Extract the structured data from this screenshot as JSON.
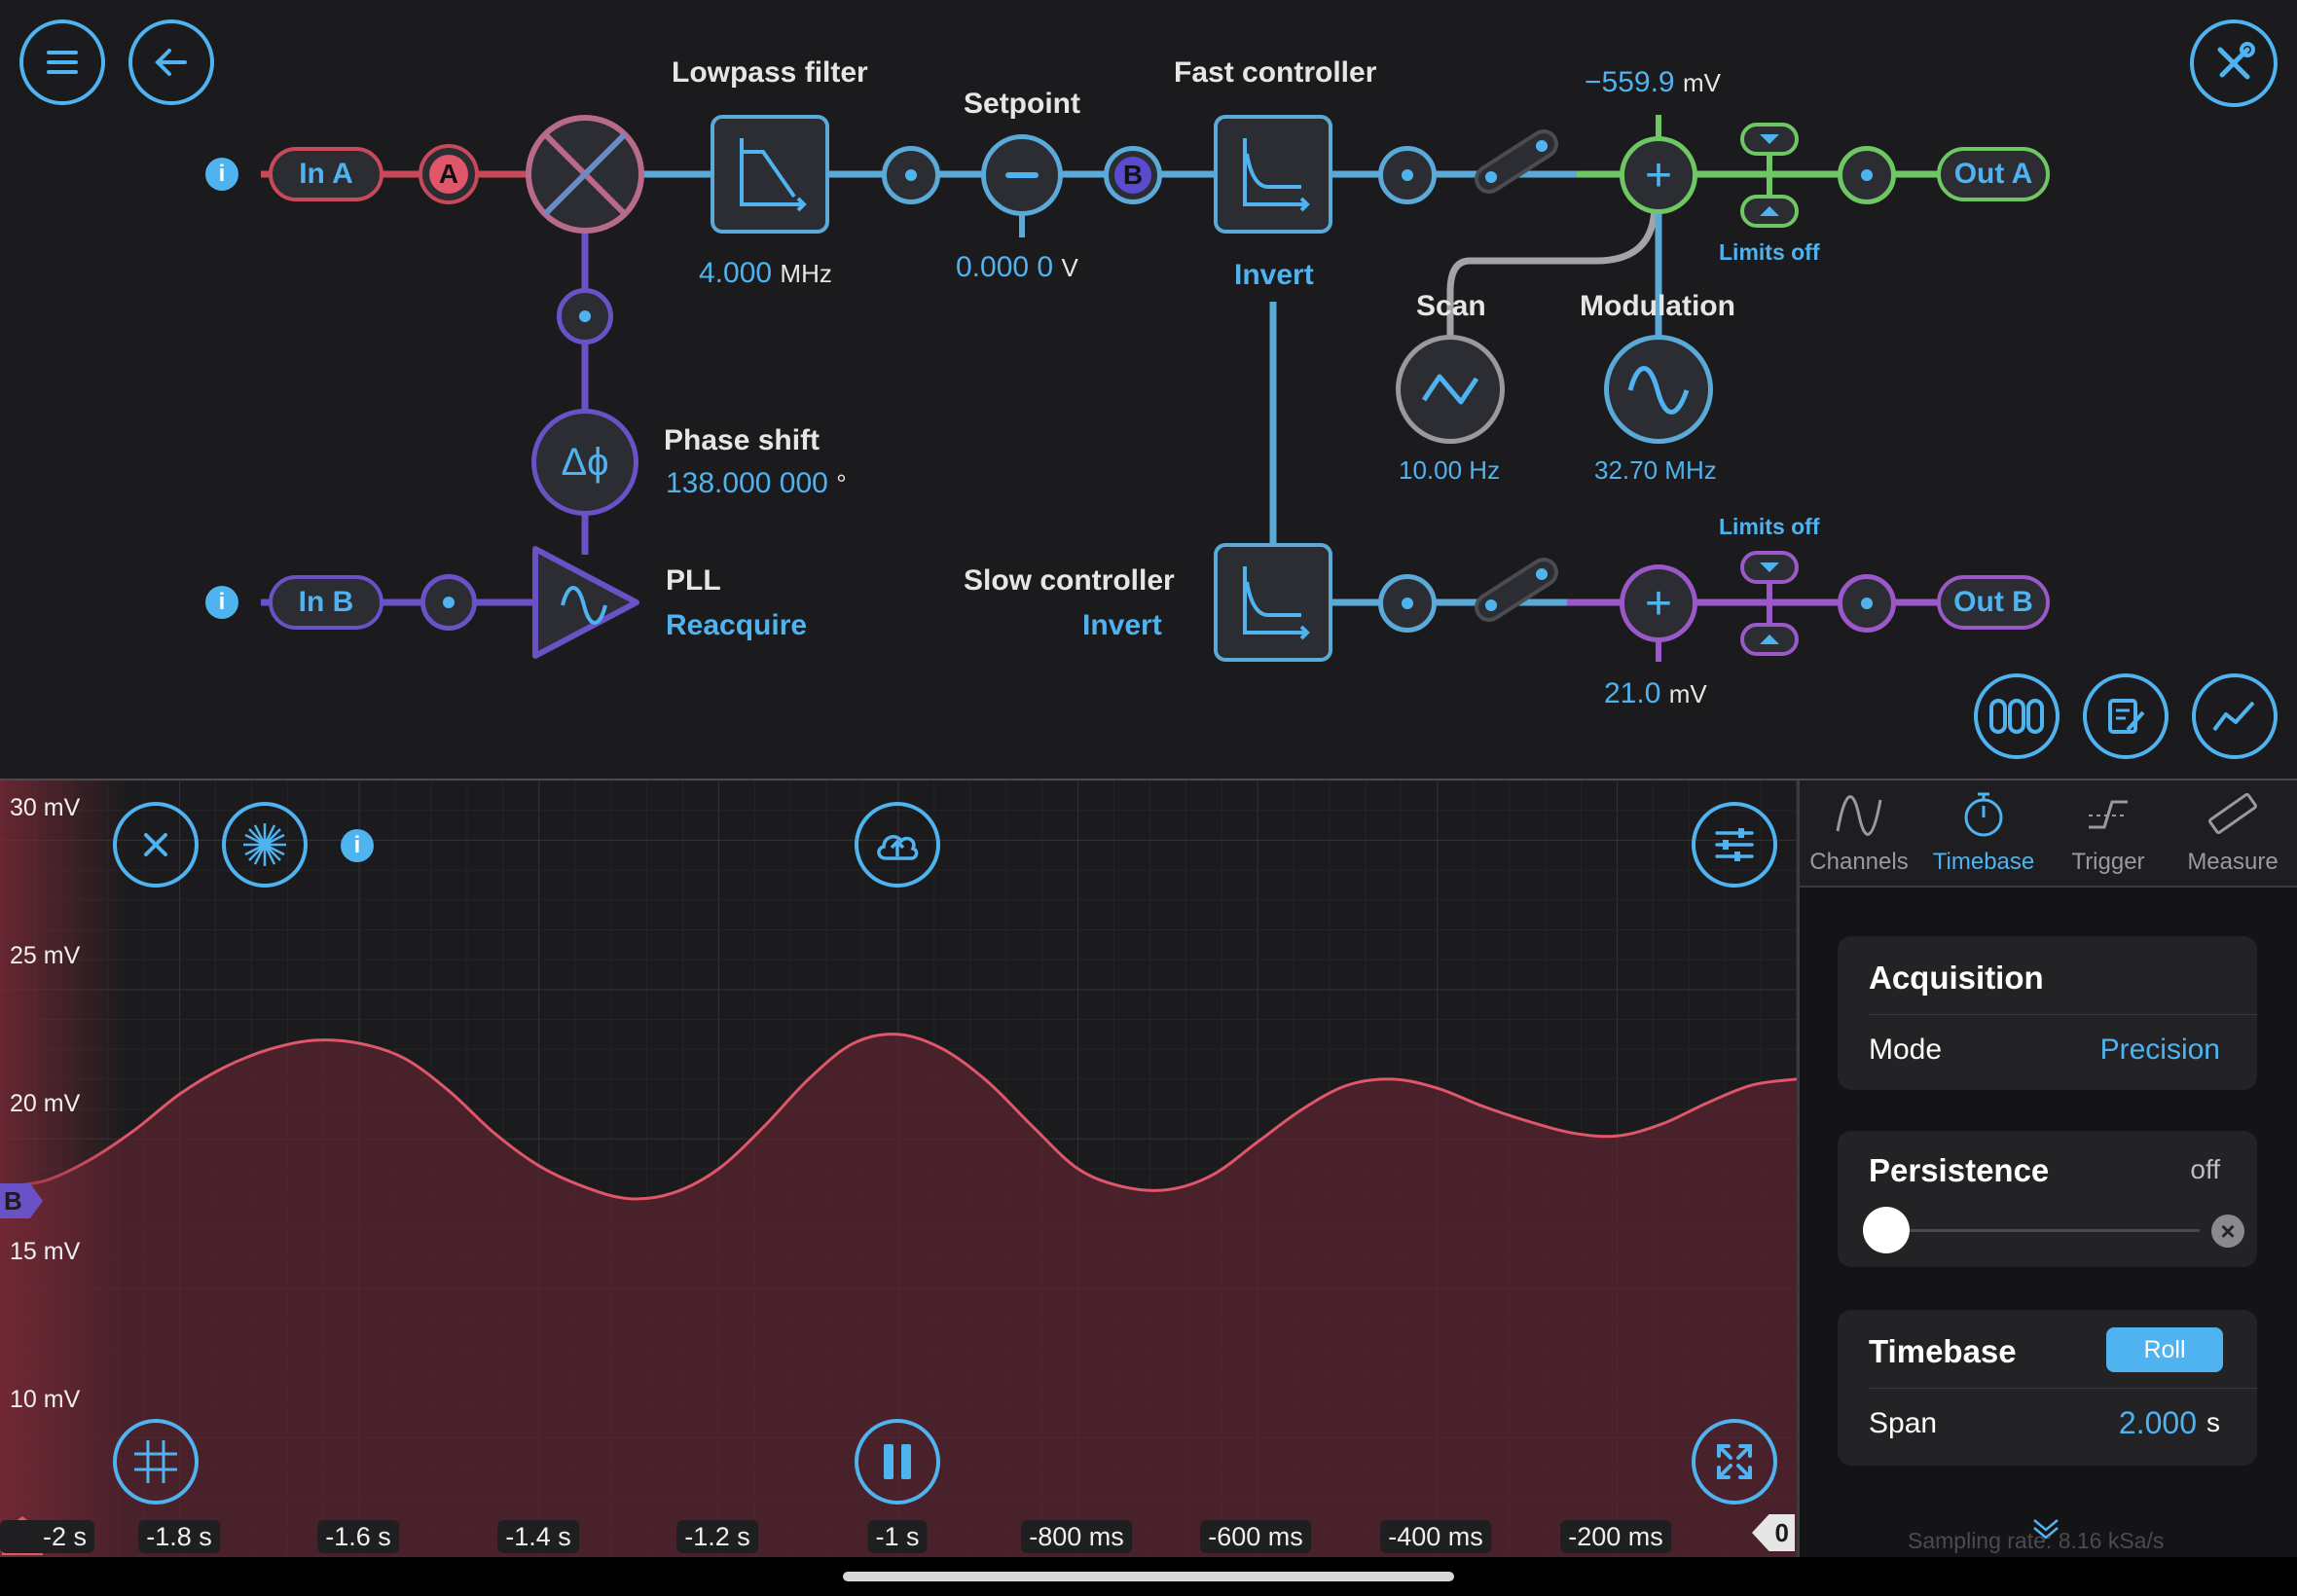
{
  "top": {
    "in_a": "In A",
    "in_b": "In B",
    "marker_a": "A",
    "marker_b": "B",
    "lowpass": {
      "title": "Lowpass filter",
      "value": "4.000",
      "unit": "MHz"
    },
    "setpoint": {
      "title": "Setpoint",
      "value": "0.000 0",
      "unit": "V"
    },
    "fast_controller": {
      "title": "Fast controller",
      "invert": "Invert"
    },
    "slow_controller": {
      "title": "Slow controller",
      "invert": "Invert"
    },
    "phase_shift": {
      "title": "Phase shift",
      "value": "138.000 000",
      "unit": "°"
    },
    "pll": {
      "title": "PLL",
      "action": "Reacquire"
    },
    "scan": {
      "title": "Scan",
      "value": "10.00 Hz"
    },
    "modulation": {
      "title": "Modulation",
      "value": "32.70 MHz"
    },
    "offset_a": {
      "value": "−559.9",
      "unit": "mV"
    },
    "offset_b": {
      "value": "21.0",
      "unit": "mV"
    },
    "limits_a": "Limits off",
    "limits_b": "Limits off",
    "out_a": "Out A",
    "out_b": "Out B",
    "phase_symbol": "Δϕ"
  },
  "scope": {
    "y_labels": [
      "30 mV",
      "25 mV",
      "20 mV",
      "15 mV",
      "10 mV"
    ],
    "x_labels": [
      "-2 s",
      "-1.8 s",
      "-1.6 s",
      "-1.4 s",
      "-1.2 s",
      "-1 s",
      "-800 ms",
      "-600 ms",
      "-400 ms",
      "-200 ms"
    ],
    "marker_a": "A",
    "marker_b": "B",
    "marker_zero": "0",
    "trace_color": "#e0566b",
    "y_range_mv": [
      6,
      32
    ],
    "x_range_s": [
      -2.0,
      0.0
    ],
    "trace_mv": [
      [
        -2.0,
        18.4
      ],
      [
        -1.95,
        18.6
      ],
      [
        -1.9,
        19.3
      ],
      [
        -1.85,
        20.3
      ],
      [
        -1.8,
        21.5
      ],
      [
        -1.75,
        22.4
      ],
      [
        -1.7,
        23.0
      ],
      [
        -1.65,
        23.3
      ],
      [
        -1.6,
        23.2
      ],
      [
        -1.55,
        22.7
      ],
      [
        -1.5,
        21.6
      ],
      [
        -1.45,
        20.2
      ],
      [
        -1.4,
        19.1
      ],
      [
        -1.35,
        18.4
      ],
      [
        -1.3,
        18.0
      ],
      [
        -1.25,
        18.2
      ],
      [
        -1.2,
        19.0
      ],
      [
        -1.15,
        20.4
      ],
      [
        -1.1,
        22.0
      ],
      [
        -1.05,
        23.2
      ],
      [
        -1.0,
        23.5
      ],
      [
        -0.95,
        23.0
      ],
      [
        -0.9,
        21.9
      ],
      [
        -0.85,
        20.4
      ],
      [
        -0.8,
        19.0
      ],
      [
        -0.75,
        18.4
      ],
      [
        -0.7,
        18.3
      ],
      [
        -0.65,
        18.8
      ],
      [
        -0.6,
        19.9
      ],
      [
        -0.55,
        21.0
      ],
      [
        -0.5,
        21.8
      ],
      [
        -0.45,
        22.0
      ],
      [
        -0.4,
        21.7
      ],
      [
        -0.35,
        21.1
      ],
      [
        -0.3,
        20.6
      ],
      [
        -0.25,
        20.2
      ],
      [
        -0.2,
        20.1
      ],
      [
        -0.15,
        20.5
      ],
      [
        -0.1,
        21.2
      ],
      [
        -0.05,
        21.8
      ],
      [
        0.0,
        22.0
      ]
    ]
  },
  "side": {
    "tabs": [
      "Channels",
      "Timebase",
      "Trigger",
      "Measure"
    ],
    "active_tab": "Timebase",
    "acquisition": {
      "title": "Acquisition",
      "mode_label": "Mode",
      "mode_value": "Precision"
    },
    "persistence": {
      "title": "Persistence",
      "state": "off"
    },
    "timebase": {
      "title": "Timebase",
      "roll": "Roll",
      "span_label": "Span",
      "span_value": "2.000",
      "span_unit": "s"
    },
    "sampling_rate": "Sampling rate: 8.16 kSa/s"
  },
  "colors": {
    "accent": "#4fb3f0",
    "red_path": "#d0505e",
    "blue_path": "#5aa9d6",
    "purple_path": "#6a52c6",
    "green_path": "#6fc764",
    "magenta_path": "#9b58c8"
  }
}
